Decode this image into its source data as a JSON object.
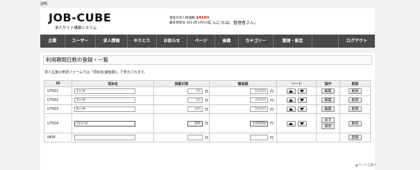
{
  "top_note": "説明",
  "header": {
    "logo": "JOB-CUBE",
    "subtitle": "求人サイト構築システム",
    "stats": {
      "jobs_label": "現在の求人情報数",
      "jobs_count": "1410",
      "jobs_unit": "件",
      "update_label": "最終更新日",
      "update_date": "2013年1月14日"
    },
    "greeting": "こんにちは。管理者さん。"
  },
  "nav": [
    {
      "label": "企業"
    },
    {
      "label": "ユーザー"
    },
    {
      "label": "求人情報"
    },
    {
      "label": "やりとり"
    },
    {
      "label": "お知らせ"
    },
    {
      "label": "ページ"
    },
    {
      "label": "画像"
    },
    {
      "label": "カテゴリー"
    },
    {
      "label": "管理・設定"
    },
    {
      "label": ""
    },
    {
      "label": "ログアウト"
    }
  ],
  "page": {
    "title": "利用期間日数の登録・一覧",
    "description": "求人企業の申請フォームでは「項目名(課金額)」で表示されます。"
  },
  "table": {
    "headers": {
      "id": "ID",
      "name": "項目名",
      "days": "掲載日数",
      "fee": "課金額",
      "sort": "ソート",
      "op": "操作",
      "del": "削除"
    },
    "day_unit": "日",
    "fee_unit": "円",
    "rows": [
      {
        "id": "UT001",
        "name": "1ヶ月",
        "days": "30",
        "fee": "10000"
      },
      {
        "id": "UT002",
        "name": "3ヶ月",
        "days": "90",
        "fee": "25000"
      },
      {
        "id": "UT003",
        "name": "6ヶ月",
        "days": "180",
        "fee": "50000"
      },
      {
        "id": "UT004",
        "name": "12ヶ月",
        "days": "365",
        "fee": "100000"
      }
    ],
    "new_row": {
      "id": "NEW",
      "name": "",
      "days": "",
      "fee": ""
    },
    "buttons": {
      "edit": "編集",
      "delete": "削除",
      "back": "戻す",
      "save": "保存",
      "register": "登録"
    }
  },
  "footer": {
    "link": "▲ページ上部へ"
  }
}
